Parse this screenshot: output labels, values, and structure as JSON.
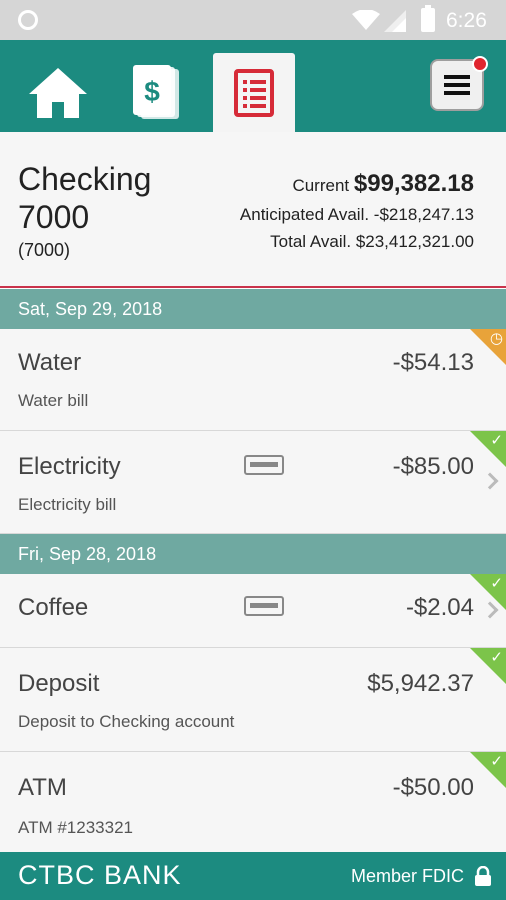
{
  "status_bar": {
    "time": "6:26"
  },
  "nav": {
    "tabs": [
      {
        "name": "home",
        "icon": "home-icon"
      },
      {
        "name": "transfer",
        "icon": "dollar-document-icon"
      },
      {
        "name": "statements",
        "icon": "statement-list-icon",
        "active": true
      }
    ],
    "menu_icon": "hamburger-menu-icon",
    "notification": true
  },
  "account": {
    "name": "Checking 7000",
    "number": "(7000)",
    "current_label": "Current",
    "current_value": "$99,382.18",
    "anticipated": "Anticipated Avail. -$218,247.13",
    "total": "Total Avail. $23,412,321.00"
  },
  "groups": [
    {
      "date": "Sat, Sep 29, 2018",
      "transactions": [
        {
          "name": "Water",
          "description": "Water bill",
          "amount": "-$54.13",
          "status": "pending"
        },
        {
          "name": "Electricity",
          "description": "Electricity bill",
          "amount": "-$85.00",
          "status": "cleared",
          "card": true
        }
      ]
    },
    {
      "date": "Fri, Sep 28, 2018",
      "transactions": [
        {
          "name": "Coffee",
          "description": "",
          "amount": "-$2.04",
          "status": "cleared",
          "card": true
        },
        {
          "name": "Deposit",
          "description": "Deposit to Checking account",
          "amount": "$5,942.37",
          "status": "cleared"
        },
        {
          "name": "ATM",
          "description": "ATM #1233321",
          "amount": "-$50.00",
          "status": "cleared"
        }
      ]
    }
  ],
  "footer": {
    "logo": "CTBC BANK",
    "member": "Member FDIC"
  },
  "colors": {
    "brand": "#1c8b80",
    "date_header": "#6fa9a1",
    "accent": "#c9334b",
    "cleared": "#7cc44a",
    "pending": "#e8a33a"
  }
}
